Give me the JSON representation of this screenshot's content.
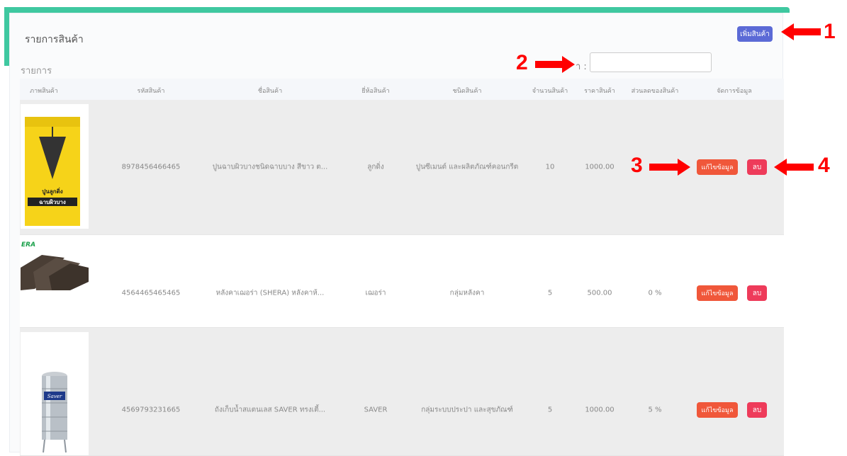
{
  "page": {
    "title": "รายการสินค้า",
    "add_button_label": "เพิ่มสินค้า",
    "list_label": "รายการ",
    "search_label": "า :",
    "search_value": ""
  },
  "table": {
    "headers": [
      "ภาพสินค้า",
      "รหัสสินค้า",
      "ชื่อสินค้า",
      "ยี่ห้อสินค้า",
      "ชนิดสินค้า",
      "จำนวนสินค้า",
      "ราคาสินค้า",
      "ส่วนลดของสินค้า",
      "จัดการข้อมูล"
    ],
    "rows": [
      {
        "code": "8978456466465",
        "name": "ปูนฉาบผิวบางชนิดฉาบบาง สีขาว ต...",
        "brand": "ลูกดิ่ง",
        "type": "ปูนซีเมนต์ และผลิตภัณฑ์คอนกรีต",
        "qty": "10",
        "price": "1000.00",
        "discount": "",
        "edit_label": "แก้ไขข้อมูล",
        "delete_label": "ลบ"
      },
      {
        "code": "4564465465465",
        "name": "หลังคาเฌอร่า (SHERA) หลังคาห้...",
        "brand": "เฌอร่า",
        "type": "กลุ่มหลังคา",
        "qty": "5",
        "price": "500.00",
        "discount": "0 %",
        "edit_label": "แก้ไขข้อมูล",
        "delete_label": "ลบ"
      },
      {
        "code": "4569793231665",
        "name": "ถังเก็บน้ำสแตนเลส SAVER ทรงเตี้...",
        "brand": "SAVER",
        "type": "กลุ่มระบบประปา และสุขภัณฑ์",
        "qty": "5",
        "price": "1000.00",
        "discount": "5 %",
        "edit_label": "แก้ไขข้อมูล",
        "delete_label": "ลบ"
      }
    ]
  },
  "product_images": {
    "bag_title": "ปูนลูกดิ่ง",
    "bag_subtitle": "ฉาบผิวบาง",
    "roof_brand": "ERA",
    "tank_brand": "Saver"
  },
  "annotations": [
    "1",
    "2",
    "3",
    "4"
  ],
  "colors": {
    "accent": "#3fc8a0",
    "add_button": "#5b6ad6",
    "edit_button": "#f0573a",
    "delete_button": "#ee3b5a",
    "annotation": "#ff0000"
  }
}
